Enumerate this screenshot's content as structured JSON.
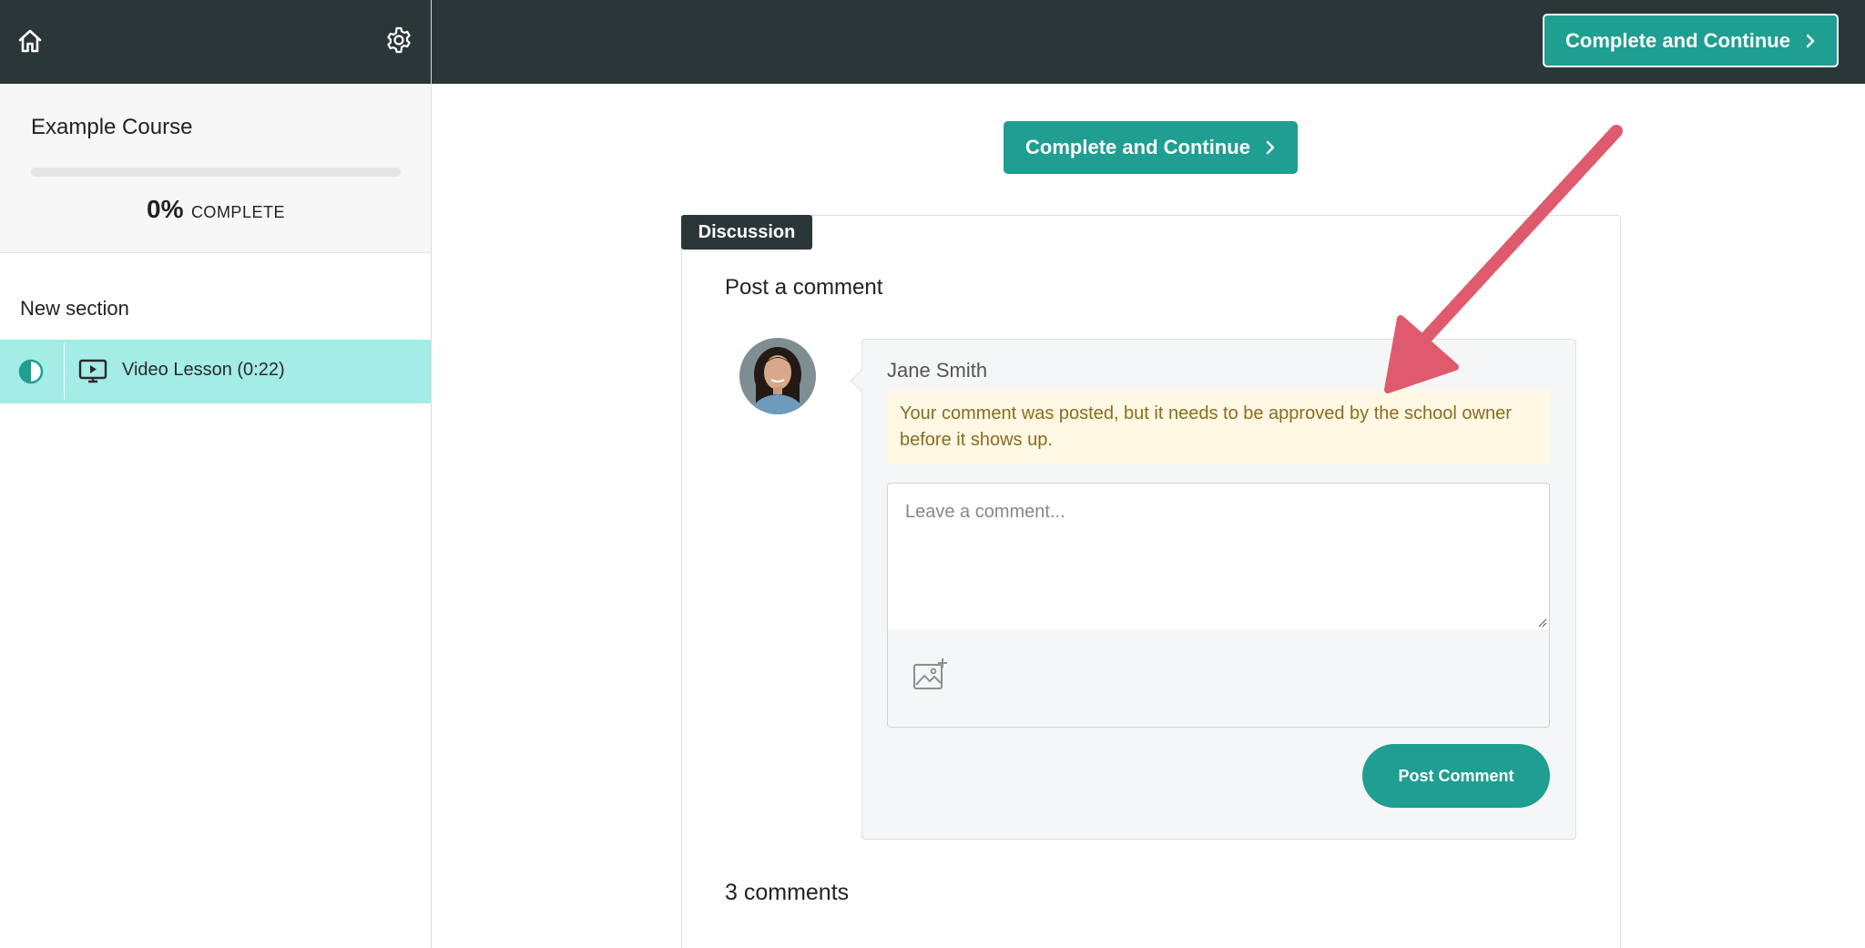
{
  "sidebar": {
    "home_icon": "home-icon",
    "settings_icon": "gear-icon",
    "course_title": "Example Course",
    "progress": {
      "percent": 0,
      "percent_label": "0%",
      "label": "COMPLETE"
    },
    "section_title": "New section",
    "lessons": [
      {
        "label": "Video Lesson (0:22)",
        "icon": "video-icon",
        "status_icon": "half-circle-status-icon",
        "active": true
      }
    ]
  },
  "topbar": {
    "complete_button_label": "Complete and Continue"
  },
  "main": {
    "complete_button_label": "Complete and Continue",
    "discussion": {
      "tag": "Discussion",
      "heading": "Post a comment",
      "comment_form": {
        "author": "Jane Smith",
        "notice": "Your comment was posted, but it needs to be approved by the school owner before it shows up.",
        "placeholder": "Leave a comment...",
        "attach_icon": "image-add-icon",
        "post_button": "Post Comment"
      },
      "comments_count": "3 comments"
    }
  },
  "colors": {
    "dark_header": "#2b3638",
    "accent": "#1f9e92",
    "active_lesson_bg": "#a4ece6",
    "notice_bg": "#fff8e5",
    "notice_text": "#8a6d1d",
    "annotation_arrow": "#e05a6d"
  }
}
